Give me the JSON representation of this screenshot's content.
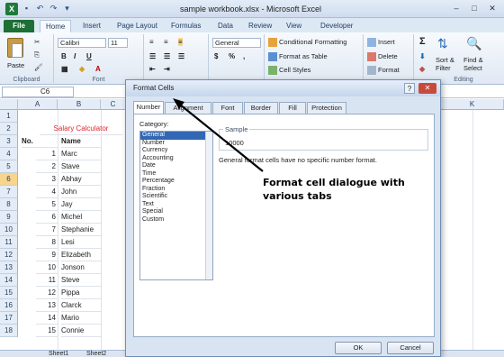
{
  "window": {
    "title": "sample workbook.xlsx - Microsoft Excel",
    "logo": "X",
    "controls": [
      "–",
      "□",
      "✕"
    ],
    "qat_icons": [
      "save-icon",
      "undo-icon",
      "redo-icon",
      "dropdown-icon"
    ]
  },
  "ribbon_tabs": [
    "File",
    "Home",
    "Insert",
    "Page Layout",
    "Formulas",
    "Data",
    "Review",
    "View",
    "Developer"
  ],
  "active_tab": "Home",
  "ribbon": {
    "clipboard": {
      "label": "Clipboard",
      "paste": "Paste"
    },
    "font": {
      "label": "Font",
      "font_name": "Calibri",
      "font_size": "11",
      "bold": "B",
      "italic": "I",
      "underline": "U"
    },
    "number": {
      "format": "General",
      "currency": "$",
      "percent": "%",
      "comma": ","
    },
    "styles": {
      "conditional": "Conditional Formatting",
      "format_table": "Format as Table",
      "cell_styles": "Cell Styles"
    },
    "cells": {
      "insert": "Insert",
      "delete": "Delete",
      "format": "Format"
    },
    "editing": {
      "label": "Editing",
      "sum": "Σ",
      "sort": "Sort &",
      "filter": "Filter",
      "find": "Find &",
      "select": "Select"
    }
  },
  "formula_bar": {
    "name_box": "C6"
  },
  "grid": {
    "columns": [
      "A",
      "B",
      "C",
      "K"
    ],
    "rows": [
      "1",
      "2",
      "3",
      "4",
      "5",
      "6",
      "7",
      "8",
      "9",
      "10",
      "11",
      "12",
      "13",
      "14",
      "15",
      "16",
      "17",
      "18"
    ],
    "selected_row": "6",
    "title": "Salary Calculator",
    "headers": {
      "no": "No.",
      "name": "Name"
    },
    "records": [
      {
        "no": "1",
        "name": "Marc"
      },
      {
        "no": "2",
        "name": "Stave"
      },
      {
        "no": "3",
        "name": "Abhay"
      },
      {
        "no": "4",
        "name": "John"
      },
      {
        "no": "5",
        "name": "Jay"
      },
      {
        "no": "6",
        "name": "Michel"
      },
      {
        "no": "7",
        "name": "Stephanie"
      },
      {
        "no": "8",
        "name": "Lesi"
      },
      {
        "no": "9",
        "name": "Elizabeth"
      },
      {
        "no": "10",
        "name": "Jonson"
      },
      {
        "no": "11",
        "name": "Steve"
      },
      {
        "no": "12",
        "name": "Pippa"
      },
      {
        "no": "13",
        "name": "Clarck"
      },
      {
        "no": "14",
        "name": "Mario"
      },
      {
        "no": "15",
        "name": "Connie"
      }
    ],
    "sheet_tabs": [
      "Sheet1",
      "Sheet2"
    ]
  },
  "dialog": {
    "title": "Format Cells",
    "help": "?",
    "close": "✕",
    "tabs": [
      "Number",
      "Alignment",
      "Font",
      "Border",
      "Fill",
      "Protection"
    ],
    "active_tab": "Number",
    "category_label": "Category:",
    "categories": [
      "General",
      "Number",
      "Currency",
      "Accounting",
      "Date",
      "Time",
      "Percentage",
      "Fraction",
      "Scientific",
      "Text",
      "Special",
      "Custom"
    ],
    "selected_category": "General",
    "sample_label": "Sample",
    "sample_value": "10000",
    "description": "General format cells have no specific number format.",
    "ok": "OK",
    "cancel": "Cancel"
  },
  "annotation": {
    "line1": "Format cell dialogue with",
    "line2": "various tabs"
  }
}
